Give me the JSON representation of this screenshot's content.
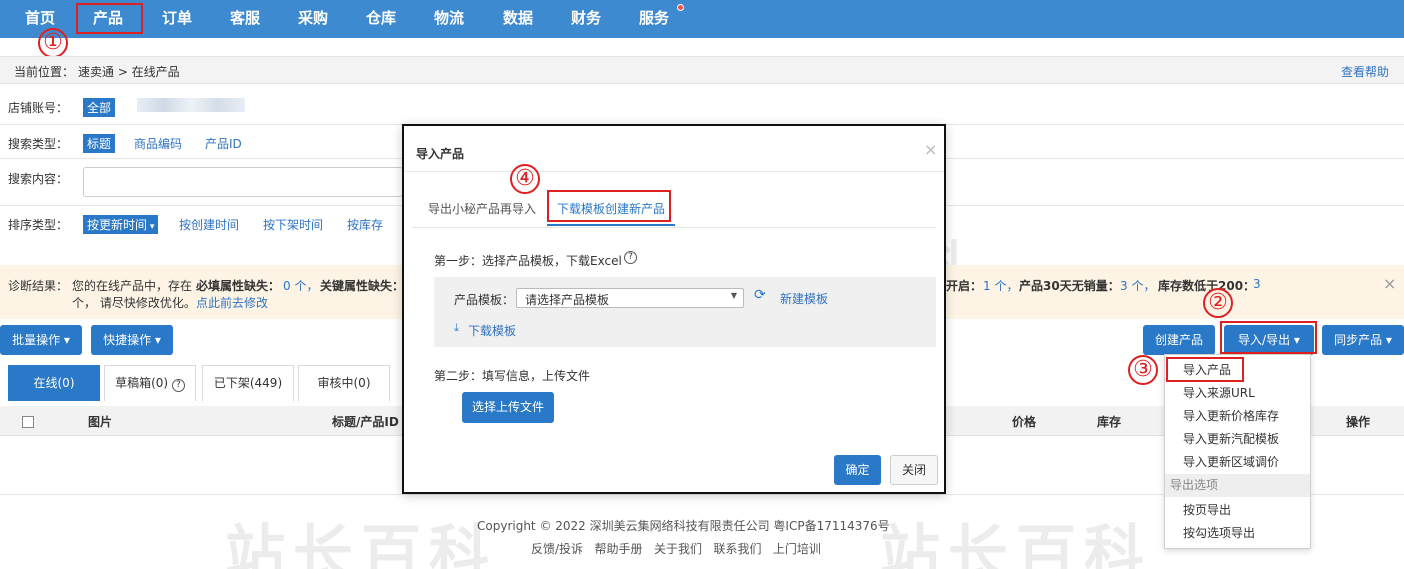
{
  "nav": {
    "items": [
      "首页",
      "产品",
      "订单",
      "客服",
      "采购",
      "仓库",
      "物流",
      "数据",
      "财务",
      "服务"
    ]
  },
  "annotations": {
    "n1": "①",
    "n2": "②",
    "n3": "③",
    "n4": "④"
  },
  "breadcrumb": {
    "prefix": "当前位置：",
    "path": "速卖通 > 在线产品",
    "help": "查看帮助"
  },
  "filters": {
    "shop_label": "店铺账号：",
    "shop_all": "全部",
    "search_type_label": "搜索类型：",
    "search_types": [
      "标题",
      "商品编码",
      "产品ID"
    ],
    "search_content_label": "搜索内容：",
    "search_placeholder": "",
    "sort_label": "排序类型：",
    "sort_selected": "按更新时间",
    "sort_options": [
      "按创建时间",
      "按下架时间",
      "按库存"
    ]
  },
  "diagnosis": {
    "label": "诊断结果：",
    "text1": "您的在线产品中，存在",
    "required_attr": "必填属性缺失：",
    "required_count": "0 个，",
    "key_attr": "关键属性缺失：",
    "right_prefix": "开启：",
    "right_count1": "1 个，",
    "no_sales": "产品30天无销量：",
    "no_sales_count": "3 个，",
    "low_stock": "库存数低于200：",
    "low_stock_count": "3",
    "line2": "个，  请尽快修改优化。",
    "fix_link": "点此前去修改"
  },
  "toolbar": {
    "batch": "批量操作",
    "quick": "快捷操作",
    "create": "创建产品",
    "import_export": "导入/导出",
    "sync": "同步产品"
  },
  "tabs": [
    "在线(0)",
    "草稿箱(0)",
    "已下架(449)",
    "审核中(0)"
  ],
  "table": {
    "headers": {
      "image": "图片",
      "title": "标题/产品ID",
      "price": "价格",
      "stock": "库存",
      "action": "操作"
    }
  },
  "dropdown": {
    "items": [
      "导入产品",
      "导入来源URL",
      "导入更新价格库存",
      "导入更新汽配模板",
      "导入更新区域调价"
    ],
    "export_header": "导出选项",
    "export_items": [
      "按页导出",
      "按勾选项导出"
    ]
  },
  "modal": {
    "title": "导入产品",
    "close": "×",
    "tabs": [
      "导出小秘产品再导入",
      "下载模板创建新产品"
    ],
    "step1": "第一步：选择产品模板，下载Excel",
    "help": "?",
    "template_label": "产品模板：",
    "template_value": "请选择产品模板",
    "new_template": "新建模板",
    "download": "下载模板",
    "step2": "第二步：填写信息，上传文件",
    "upload": "选择上传文件",
    "ok": "确定",
    "close_btn": "关闭"
  },
  "footer": {
    "copyright": "Copyright © 2022 深圳美云集网络科技有限责任公司 粤ICP备17114376号",
    "links": [
      "反馈/投诉",
      "帮助手册",
      "关于我们",
      "联系我们",
      "上门培训"
    ]
  },
  "colors": {
    "nav": "#3e8ad1",
    "primary": "#2a78c8",
    "annotation": "#e02020"
  }
}
